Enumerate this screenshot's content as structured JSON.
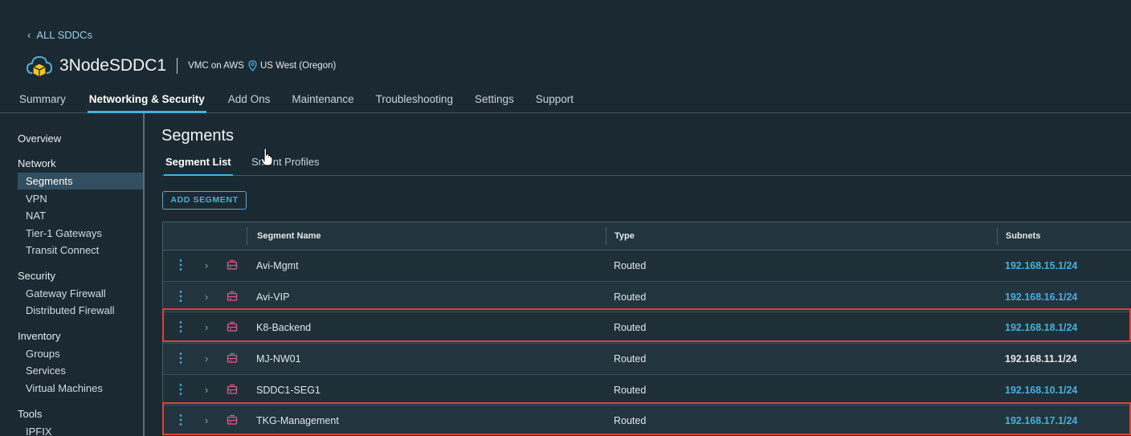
{
  "header": {
    "back_link": "ALL SDDCs",
    "sddc_name": "3NodeSDDC1",
    "provider": "VMC on AWS",
    "region": "US West (Oregon)",
    "icons": [
      "cloud-box-icon",
      "location-pin-icon"
    ]
  },
  "tabs": [
    "Summary",
    "Networking & Security",
    "Add Ons",
    "Maintenance",
    "Troubleshooting",
    "Settings",
    "Support"
  ],
  "active_tab": "Networking & Security",
  "sidebar": {
    "overview": "Overview",
    "network": {
      "title": "Network",
      "items": [
        "Segments",
        "VPN",
        "NAT",
        "Tier-1 Gateways",
        "Transit Connect"
      ]
    },
    "security": {
      "title": "Security",
      "items": [
        "Gateway Firewall",
        "Distributed Firewall"
      ]
    },
    "inventory": {
      "title": "Inventory",
      "items": [
        "Groups",
        "Services",
        "Virtual Machines"
      ]
    },
    "tools": {
      "title": "Tools",
      "items": [
        "IPFIX"
      ]
    },
    "active_item": "Segments"
  },
  "main": {
    "title": "Segments",
    "subtabs": [
      "Segment List",
      "Segment Profiles"
    ],
    "subtab_second_visible": "Sment Profiles",
    "add_button": "ADD SEGMENT",
    "columns": [
      "Segment Name",
      "Type",
      "Subnets"
    ],
    "rows": [
      {
        "name": "Avi-Mgmt",
        "type": "Routed",
        "subnet": "192.168.15.1/24"
      },
      {
        "name": "Avi-VIP",
        "type": "Routed",
        "subnet": "192.168.16.1/24"
      },
      {
        "name": "K8-Backend",
        "type": "Routed",
        "subnet": "192.168.18.1/24"
      },
      {
        "name": "MJ-NW01",
        "type": "Routed",
        "subnet": "192.168.11.1/24"
      },
      {
        "name": "SDDC1-SEG1",
        "type": "Routed",
        "subnet": "192.168.10.1/24"
      },
      {
        "name": "TKG-Management",
        "type": "Routed",
        "subnet": "192.168.17.1/24"
      }
    ]
  },
  "colors": {
    "accent": "#49afd9",
    "highlight": "#e0413b",
    "segment_icon": "#e05a8a"
  }
}
